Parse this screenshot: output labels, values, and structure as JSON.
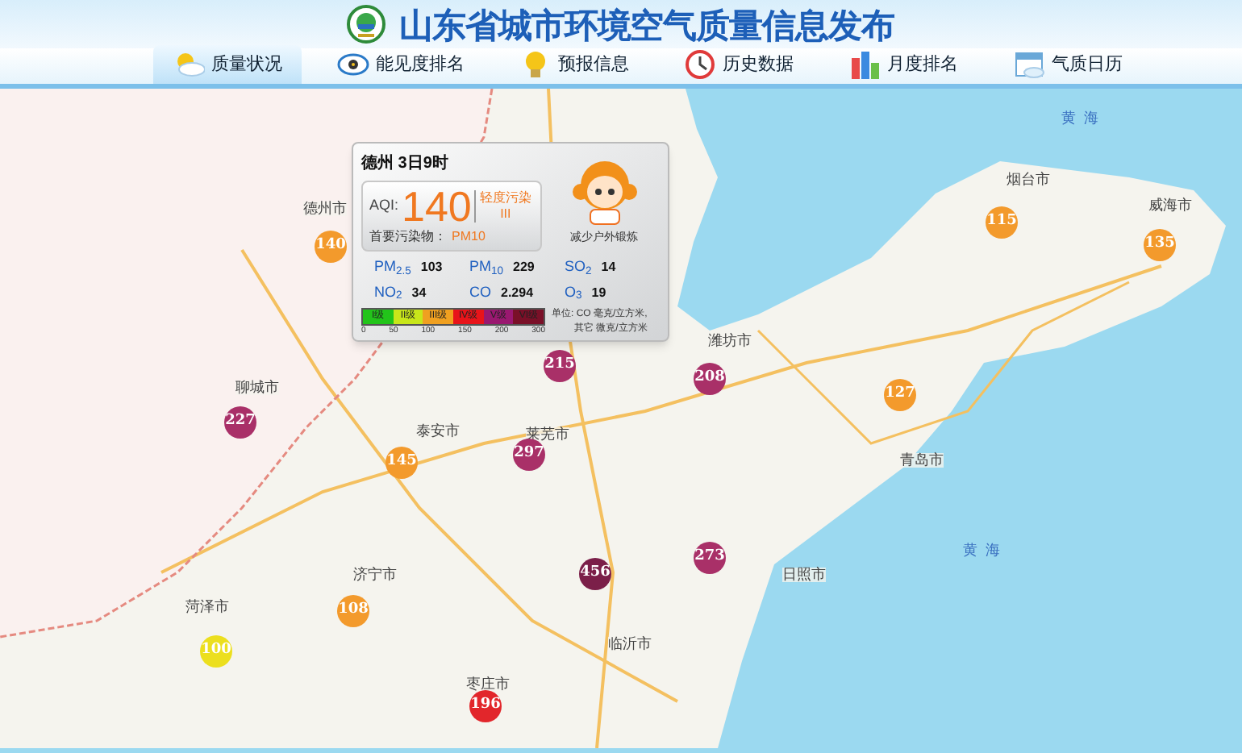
{
  "header": {
    "title": "山东省城市环境空气质量信息发布"
  },
  "tabs": [
    {
      "label": "质量状况",
      "selected": true
    },
    {
      "label": "能见度排名",
      "selected": false
    },
    {
      "label": "预报信息",
      "selected": false
    },
    {
      "label": "历史数据",
      "selected": false
    },
    {
      "label": "月度排名",
      "selected": false
    },
    {
      "label": "气质日历",
      "selected": false
    }
  ],
  "map": {
    "sea_labels": [
      "黄  海",
      "黄  海"
    ],
    "cities": [
      "德州市",
      "烟台市",
      "威海市",
      "潍坊市",
      "聊城市",
      "泰安市",
      "莱芜市",
      "青岛市",
      "日照市",
      "济宁市",
      "菏泽市",
      "临沂市",
      "枣庄市"
    ],
    "markers": [
      {
        "value": "140",
        "color": "#f39a2c"
      },
      {
        "value": "115",
        "color": "#f39a2c"
      },
      {
        "value": "135",
        "color": "#f39a2c"
      },
      {
        "value": "215",
        "color": "#a93068"
      },
      {
        "value": "208",
        "color": "#a93068"
      },
      {
        "value": "127",
        "color": "#f39a2c"
      },
      {
        "value": "227",
        "color": "#a93068"
      },
      {
        "value": "145",
        "color": "#f39a2c"
      },
      {
        "value": "297",
        "color": "#a93068"
      },
      {
        "value": "456",
        "color": "#7b1f49"
      },
      {
        "value": "273",
        "color": "#a93068"
      },
      {
        "value": "108",
        "color": "#f39a2c"
      },
      {
        "value": "100",
        "color": "#ecdf1e"
      },
      {
        "value": "196",
        "color": "#e2262b"
      }
    ]
  },
  "popup": {
    "title": "德州 3日9时",
    "aqi_label": "AQI:",
    "aqi": "140",
    "level_text": "轻度污染",
    "level_roman": "III",
    "primary_label": "首要污染物：",
    "primary": "PM10",
    "advice": "减少户外锻炼",
    "pollutants": [
      {
        "name": "PM$_{2.5}$",
        "value": "103"
      },
      {
        "name": "PM$_{10}$",
        "value": "229"
      },
      {
        "name": "SO$_{2}$",
        "value": "14"
      },
      {
        "name": "NO$_{2}$",
        "value": "34"
      },
      {
        "name": "CO",
        "value": "2.294"
      },
      {
        "name": "O$_{3}$",
        "value": "19"
      }
    ],
    "scale": [
      {
        "label": "I级",
        "color": "#22c41a"
      },
      {
        "label": "II级",
        "color": "#c8e61a"
      },
      {
        "label": "III级",
        "color": "#f0a020"
      },
      {
        "label": "IV级",
        "color": "#e8141a"
      },
      {
        "label": "V级",
        "color": "#9a1870"
      },
      {
        "label": "VI级",
        "color": "#7a1028"
      }
    ],
    "ticks": [
      "0",
      "50",
      "100",
      "150",
      "200",
      "300"
    ],
    "units": [
      "单位: CO 毫克/立方米,",
      "其它 微克/立方米"
    ]
  }
}
